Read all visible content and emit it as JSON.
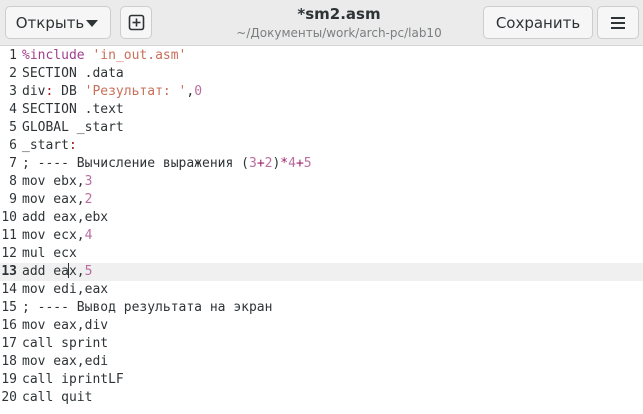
{
  "window": {
    "title": "*sm2.asm",
    "path": "~/Документы/work/arch-pc/lab10"
  },
  "toolbar": {
    "open_label": "Открыть",
    "save_label": "Сохранить",
    "new_tab_icon": "new-tab-plus-icon",
    "menu_icon": "hamburger-menu-icon"
  },
  "editor": {
    "current_line": 13,
    "lines": [
      {
        "n": "1",
        "text": "%include 'in_out.asm'"
      },
      {
        "n": "2",
        "text": "SECTION .data"
      },
      {
        "n": "3",
        "text": "div: DB 'Результат: ',0"
      },
      {
        "n": "4",
        "text": "SECTION .text"
      },
      {
        "n": "5",
        "text": "GLOBAL _start"
      },
      {
        "n": "6",
        "text": "_start:"
      },
      {
        "n": "7",
        "text": "; ---- Вычисление выражения (3+2)*4+5"
      },
      {
        "n": "8",
        "text": "mov ebx,3"
      },
      {
        "n": "9",
        "text": "mov eax,2"
      },
      {
        "n": "10",
        "text": "add eax,ebx"
      },
      {
        "n": "11",
        "text": "mov ecx,4"
      },
      {
        "n": "12",
        "text": "mul ecx"
      },
      {
        "n": "13",
        "text": "add eax,5"
      },
      {
        "n": "14",
        "text": "mov edi,eax"
      },
      {
        "n": "15",
        "text": "; ---- Вывод результата на экран"
      },
      {
        "n": "16",
        "text": "mov eax,div"
      },
      {
        "n": "17",
        "text": "call sprint"
      },
      {
        "n": "18",
        "text": "mov eax,edi"
      },
      {
        "n": "19",
        "text": "call iprintLF"
      },
      {
        "n": "20",
        "text": "call quit"
      }
    ]
  },
  "colors": {
    "headerbar": "#ebebeb",
    "text": "#2e3436",
    "current_line": "#f0f0f0",
    "preprocessor": "#a0408c",
    "string": "#c8705a",
    "number": "#b86ea0"
  }
}
